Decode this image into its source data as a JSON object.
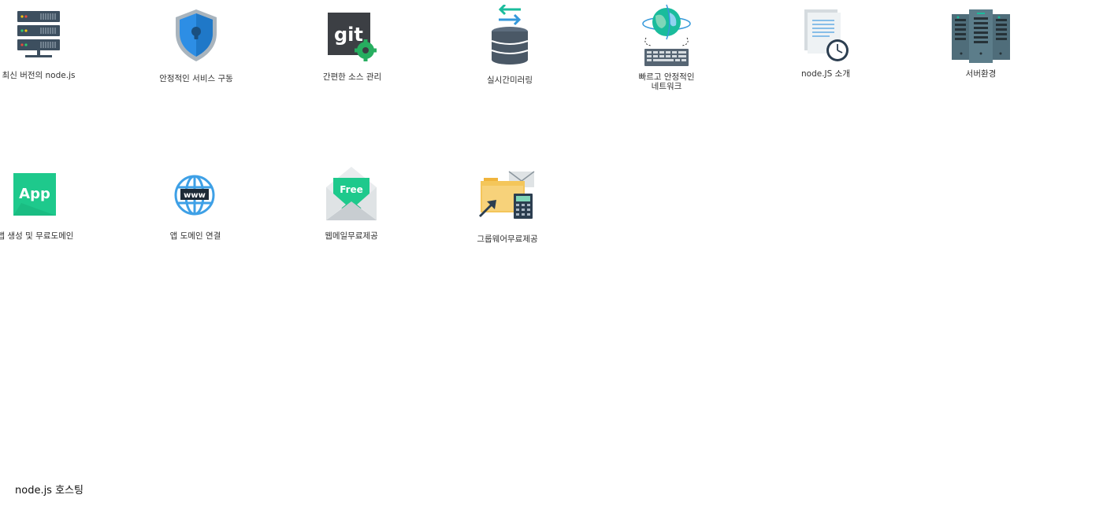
{
  "services_row1": [
    {
      "label": "최신 버전의 node.js",
      "icon": "server-icon"
    },
    {
      "label": "안정적인 서비스 구동",
      "icon": "shield-lock-icon"
    },
    {
      "label": "간편한 소스 관리",
      "icon": "git-icon"
    },
    {
      "label": "실시간미러링",
      "icon": "database-sync-icon"
    },
    {
      "label": "빠르고 안정적인\n네트워크",
      "icon": "globe-network-icon"
    },
    {
      "label": "node.JS 소개",
      "icon": "document-clock-icon"
    },
    {
      "label": "서버환경",
      "icon": "server-rack-icon"
    }
  ],
  "services_row2": [
    {
      "label": "앱 생성 및 무료도메인",
      "icon": "app-icon",
      "icon_text": "App"
    },
    {
      "label": "앱 도메인 연결",
      "icon": "www-globe-icon",
      "icon_text": "www"
    },
    {
      "label": "웹메일무료제공",
      "icon": "free-mail-icon",
      "icon_text": "Free"
    },
    {
      "label": "그룹웨어무료제공",
      "icon": "groupware-icon"
    }
  ],
  "footer": {
    "title": "node.js 호스팅"
  },
  "colors": {
    "server_dark": "#3d4f5f",
    "shield_blue": "#2d8ee5",
    "git_dark": "#3c3f44",
    "git_green": "#27ae60",
    "sync_teal": "#1abc9c",
    "sync_blue": "#3498db",
    "app_green": "#1ec98c",
    "www_blue": "#3ea0e6",
    "folder_yellow": "#f4c65a"
  }
}
